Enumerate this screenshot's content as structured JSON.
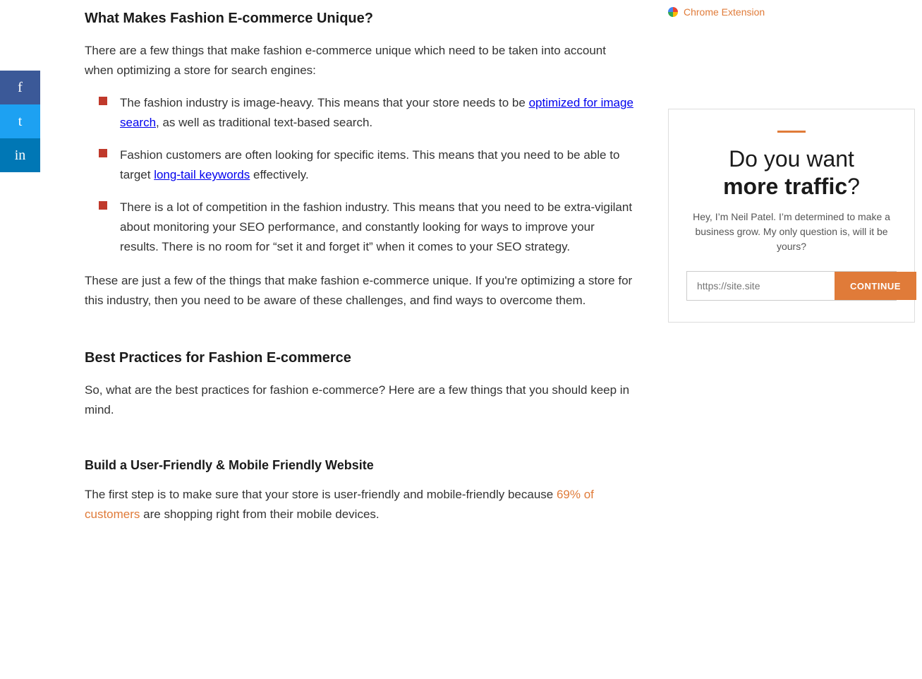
{
  "social": {
    "facebook_label": "f",
    "twitter_label": "t",
    "linkedin_label": "in"
  },
  "header": {
    "chrome_extension_label": "Chrome Extension"
  },
  "article": {
    "section1": {
      "title": "What Makes Fashion E-commerce Unique?",
      "intro": "There are a few things that make fashion e-commerce unique which need to be taken into account when optimizing a store for search engines:",
      "bullets": [
        {
          "text_before": "The fashion industry is image-heavy. This means that your store needs to be ",
          "link_text": "optimized for image search",
          "text_after": ", as well as traditional text-based search."
        },
        {
          "text_before": "Fashion customers are often looking for specific items. This means that you need to be able to target ",
          "link_text": "long-tail keywords",
          "text_after": " effectively."
        },
        {
          "text_before": "There is a lot of competition in the fashion industry. This means that you need to be extra-vigilant about monitoring your SEO performance, and constantly looking for ways to improve your results. There is no room for “set it and forget it” when it comes to your SEO strategy.",
          "link_text": "",
          "text_after": ""
        }
      ],
      "outro": "These are just a few of the things that make fashion e-commerce unique. If you're optimizing a store for this industry, then you need to be aware of these challenges, and find ways to overcome them."
    },
    "section2": {
      "title": "Best Practices for Fashion E-commerce",
      "intro": "So, what are the best practices for fashion e-commerce? Here are a few things that you should keep in mind."
    },
    "section3": {
      "title": "Build a User-Friendly & Mobile Friendly Website",
      "intro_before": "The first step is to make sure that your store is user-friendly and mobile-friendly because ",
      "intro_link": "69% of customers",
      "intro_after": " are shopping right from their mobile devices."
    }
  },
  "widget": {
    "accent": "#e07b39",
    "title_line1": "Do you want",
    "title_bold": "more traffic",
    "title_punct": "?",
    "description": "Hey, I’m Neil Patel. I’m determined to make a business grow. My only question is, will it be yours?",
    "input_placeholder": "https://site.site",
    "button_label": "CONTINUE"
  }
}
